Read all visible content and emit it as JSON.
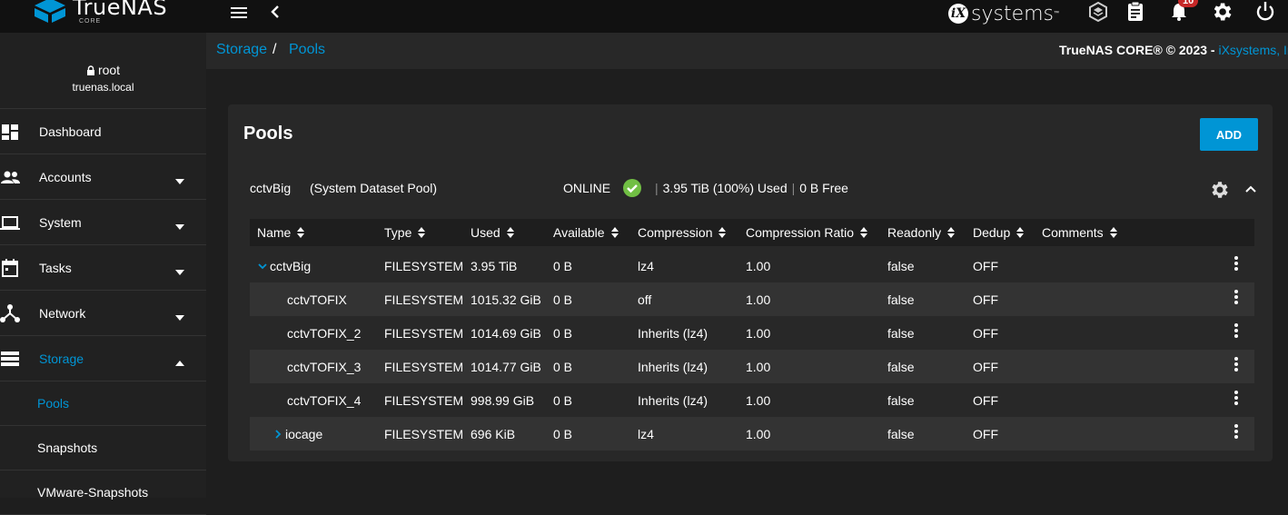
{
  "app": {
    "brand": "TrueNAS",
    "brand_sub": "CORE",
    "vendor": "systems",
    "notification_count": "10"
  },
  "sidebar": {
    "user": "root",
    "host": "truenas.local",
    "items": [
      {
        "label": "Dashboard",
        "icon": "dashboard-icon"
      },
      {
        "label": "Accounts",
        "icon": "accounts-icon"
      },
      {
        "label": "System",
        "icon": "system-icon"
      },
      {
        "label": "Tasks",
        "icon": "tasks-icon"
      },
      {
        "label": "Network",
        "icon": "network-icon"
      },
      {
        "label": "Storage",
        "icon": "storage-icon"
      }
    ],
    "storage_sub": [
      {
        "label": "Pools"
      },
      {
        "label": "Snapshots"
      },
      {
        "label": "VMware-Snapshots"
      }
    ]
  },
  "breadcrumb": {
    "root": "Storage",
    "current": "Pools",
    "separator": "/"
  },
  "copyright": {
    "text": "TrueNAS CORE® © 2023 - ",
    "link": "iXsystems, Inc"
  },
  "card": {
    "title": "Pools",
    "add_label": "ADD"
  },
  "pool": {
    "name": "cctvBig",
    "system_label": "(System Dataset Pool)",
    "status": "ONLINE",
    "used": "3.95 TiB (100%) Used",
    "free": "0 B Free",
    "separator": "|"
  },
  "table": {
    "columns": [
      "Name",
      "Type",
      "Used",
      "Available",
      "Compression",
      "Compression Ratio",
      "Readonly",
      "Dedup",
      "Comments"
    ],
    "rows": [
      {
        "name": "cctvBig",
        "type": "FILESYSTEM",
        "used": "3.95 TiB",
        "available": "0 B",
        "compression": "lz4",
        "ratio": "1.00",
        "readonly": "false",
        "dedup": "OFF",
        "comments": ""
      },
      {
        "name": "cctvTOFIX",
        "type": "FILESYSTEM",
        "used": "1015.32 GiB",
        "available": "0 B",
        "compression": "off",
        "ratio": "1.00",
        "readonly": "false",
        "dedup": "OFF",
        "comments": ""
      },
      {
        "name": "cctvTOFIX_2",
        "type": "FILESYSTEM",
        "used": "1014.69 GiB",
        "available": "0 B",
        "compression": "Inherits (lz4)",
        "ratio": "1.00",
        "readonly": "false",
        "dedup": "OFF",
        "comments": ""
      },
      {
        "name": "cctvTOFIX_3",
        "type": "FILESYSTEM",
        "used": "1014.77 GiB",
        "available": "0 B",
        "compression": "Inherits (lz4)",
        "ratio": "1.00",
        "readonly": "false",
        "dedup": "OFF",
        "comments": ""
      },
      {
        "name": "cctvTOFIX_4",
        "type": "FILESYSTEM",
        "used": "998.99 GiB",
        "available": "0 B",
        "compression": "Inherits (lz4)",
        "ratio": "1.00",
        "readonly": "false",
        "dedup": "OFF",
        "comments": ""
      },
      {
        "name": "iocage",
        "type": "FILESYSTEM",
        "used": "696 KiB",
        "available": "0 B",
        "compression": "lz4",
        "ratio": "1.00",
        "readonly": "false",
        "dedup": "OFF",
        "comments": ""
      }
    ]
  },
  "colors": {
    "accent": "#0095d5",
    "online": "#71bf44",
    "badge": "#c62828"
  }
}
